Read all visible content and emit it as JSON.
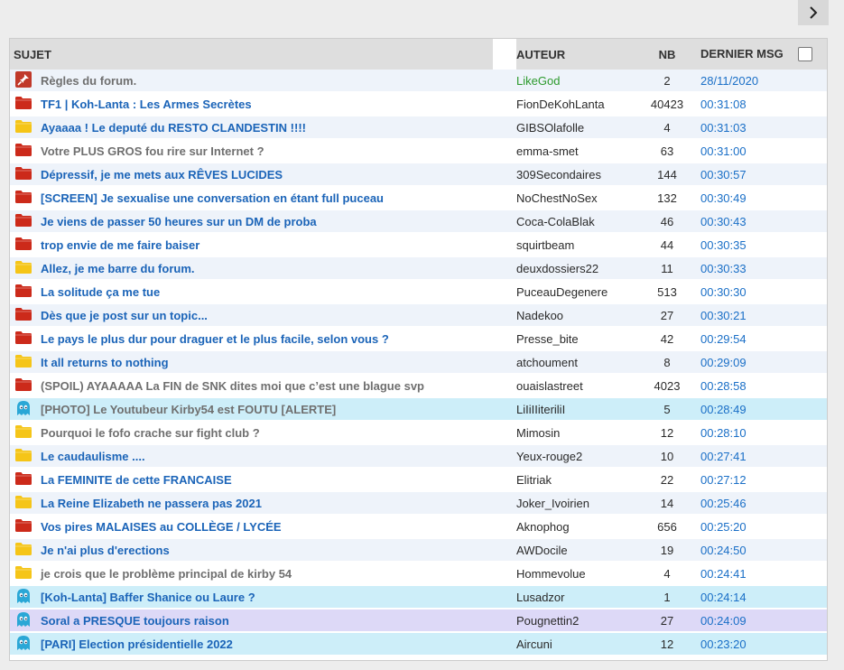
{
  "header": {
    "subject": "SUJET",
    "author": "AUTEUR",
    "nb": "NB",
    "last": "DERNIER MSG"
  },
  "colors": {
    "folder_red": "#cc2a1a",
    "folder_yellow": "#f5c518",
    "ghost_cyan": "#2aa7d6",
    "pin_red": "#c0392b",
    "link_blue": "#1b64b8",
    "author_green": "#2d9a2d"
  },
  "topics": [
    {
      "icon": "pin-icon",
      "subject": "Règles du forum.",
      "author": "LikeGod",
      "nb": "2",
      "last": "28/11/2020",
      "subject_style": "gray",
      "author_style": "green",
      "row": "odd"
    },
    {
      "icon": "red-folder-icon",
      "subject": "TF1 | Koh-Lanta : Les Armes Secrètes",
      "author": "FionDeKohLanta",
      "nb": "40423",
      "last": "00:31:08",
      "subject_style": "blue",
      "author_style": "",
      "row": "even"
    },
    {
      "icon": "yellow-folder-icon",
      "subject": "Ayaaaa ! Le deputé du RESTO CLANDESTIN !!!!",
      "author": "GIBSOlafolle",
      "nb": "4",
      "last": "00:31:03",
      "subject_style": "blue",
      "author_style": "",
      "row": "odd"
    },
    {
      "icon": "red-folder-icon",
      "subject": "Votre PLUS GROS fou rire sur Internet ?",
      "author": "emma-smet",
      "nb": "63",
      "last": "00:31:00",
      "subject_style": "gray",
      "author_style": "",
      "row": "even"
    },
    {
      "icon": "red-folder-icon",
      "subject": "Dépressif, je me mets aux RÊVES LUCIDES",
      "author": "309Secondaires",
      "nb": "144",
      "last": "00:30:57",
      "subject_style": "blue",
      "author_style": "",
      "row": "odd"
    },
    {
      "icon": "red-folder-icon",
      "subject": "[SCREEN] Je sexualise une conversation en étant full puceau",
      "author": "NoChestNoSex",
      "nb": "132",
      "last": "00:30:49",
      "subject_style": "blue",
      "author_style": "",
      "row": "even"
    },
    {
      "icon": "red-folder-icon",
      "subject": "Je viens de passer 50 heures sur un DM de proba",
      "author": "Coca-ColaBlak",
      "nb": "46",
      "last": "00:30:43",
      "subject_style": "blue",
      "author_style": "",
      "row": "odd"
    },
    {
      "icon": "red-folder-icon",
      "subject": "trop envie de me faire baiser",
      "author": "squirtbeam",
      "nb": "44",
      "last": "00:30:35",
      "subject_style": "blue",
      "author_style": "",
      "row": "even"
    },
    {
      "icon": "yellow-folder-icon",
      "subject": "Allez, je me barre du forum.",
      "author": "deuxdossiers22",
      "nb": "11",
      "last": "00:30:33",
      "subject_style": "blue",
      "author_style": "",
      "row": "odd"
    },
    {
      "icon": "red-folder-icon",
      "subject": "La solitude ça me tue",
      "author": "PuceauDegenere",
      "nb": "513",
      "last": "00:30:30",
      "subject_style": "blue",
      "author_style": "",
      "row": "even"
    },
    {
      "icon": "red-folder-icon",
      "subject": "Dès que je post sur un topic...",
      "author": "Nadekoo",
      "nb": "27",
      "last": "00:30:21",
      "subject_style": "blue",
      "author_style": "",
      "row": "odd"
    },
    {
      "icon": "red-folder-icon",
      "subject": "Le pays le plus dur pour draguer et le plus facile, selon vous ?",
      "author": "Presse_bite",
      "nb": "42",
      "last": "00:29:54",
      "subject_style": "blue",
      "author_style": "",
      "row": "even"
    },
    {
      "icon": "yellow-folder-icon",
      "subject": "It all returns to nothing",
      "author": "atchoument",
      "nb": "8",
      "last": "00:29:09",
      "subject_style": "blue",
      "author_style": "",
      "row": "odd"
    },
    {
      "icon": "red-folder-icon",
      "subject": "(SPOIL) AYAAAAA La FIN de SNK dites moi que c’est une blague svp",
      "author": "ouaislastreet",
      "nb": "4023",
      "last": "00:28:58",
      "subject_style": "gray",
      "author_style": "",
      "row": "even"
    },
    {
      "icon": "ghost-icon",
      "subject": "[PHOTO] Le Youtubeur Kirby54 est FOUTU [ALERTE]",
      "author": "LiIiIIiteriliI",
      "nb": "5",
      "last": "00:28:49",
      "subject_style": "gray",
      "author_style": "",
      "row": "cyan"
    },
    {
      "icon": "yellow-folder-icon",
      "subject": "Pourquoi le fofo crache sur fight club ?",
      "author": "Mimosin",
      "nb": "12",
      "last": "00:28:10",
      "subject_style": "gray",
      "author_style": "",
      "row": "even"
    },
    {
      "icon": "yellow-folder-icon",
      "subject": "Le caudaulisme ....",
      "author": "Yeux-rouge2",
      "nb": "10",
      "last": "00:27:41",
      "subject_style": "blue",
      "author_style": "",
      "row": "odd"
    },
    {
      "icon": "red-folder-icon",
      "subject": "La FEMINITE de cette FRANCAISE",
      "author": "Elitriak",
      "nb": "22",
      "last": "00:27:12",
      "subject_style": "blue",
      "author_style": "",
      "row": "even"
    },
    {
      "icon": "yellow-folder-icon",
      "subject": "La Reine Elizabeth ne passera pas 2021",
      "author": "Joker_Ivoirien",
      "nb": "14",
      "last": "00:25:46",
      "subject_style": "blue",
      "author_style": "",
      "row": "odd"
    },
    {
      "icon": "red-folder-icon",
      "subject": "Vos pires MALAISES au COLLÈGE / LYCÉE",
      "author": "Aknophog",
      "nb": "656",
      "last": "00:25:20",
      "subject_style": "blue",
      "author_style": "",
      "row": "even"
    },
    {
      "icon": "yellow-folder-icon",
      "subject": "Je n'ai plus d'erections",
      "author": "AWDocile",
      "nb": "19",
      "last": "00:24:50",
      "subject_style": "blue",
      "author_style": "",
      "row": "odd"
    },
    {
      "icon": "yellow-folder-icon",
      "subject": "je crois que le problème principal de kirby 54",
      "author": "Hommevolue",
      "nb": "4",
      "last": "00:24:41",
      "subject_style": "gray",
      "author_style": "",
      "row": "even"
    },
    {
      "icon": "ghost-icon",
      "subject": "[Koh-Lanta] Baffer Shanice ou Laure ?",
      "author": "Lusadzor",
      "nb": "1",
      "last": "00:24:14",
      "subject_style": "blue",
      "author_style": "",
      "row": "cyan"
    },
    {
      "icon": "ghost-icon",
      "subject": "Soral a PRESQUE toujours raison",
      "author": "Pougnettin2",
      "nb": "27",
      "last": "00:24:09",
      "subject_style": "blue",
      "author_style": "",
      "row": "purple"
    },
    {
      "icon": "ghost-icon",
      "subject": "[PARI] Election présidentielle 2022",
      "author": "Aircuni",
      "nb": "12",
      "last": "00:23:20",
      "subject_style": "blue",
      "author_style": "",
      "row": "cyan"
    }
  ]
}
